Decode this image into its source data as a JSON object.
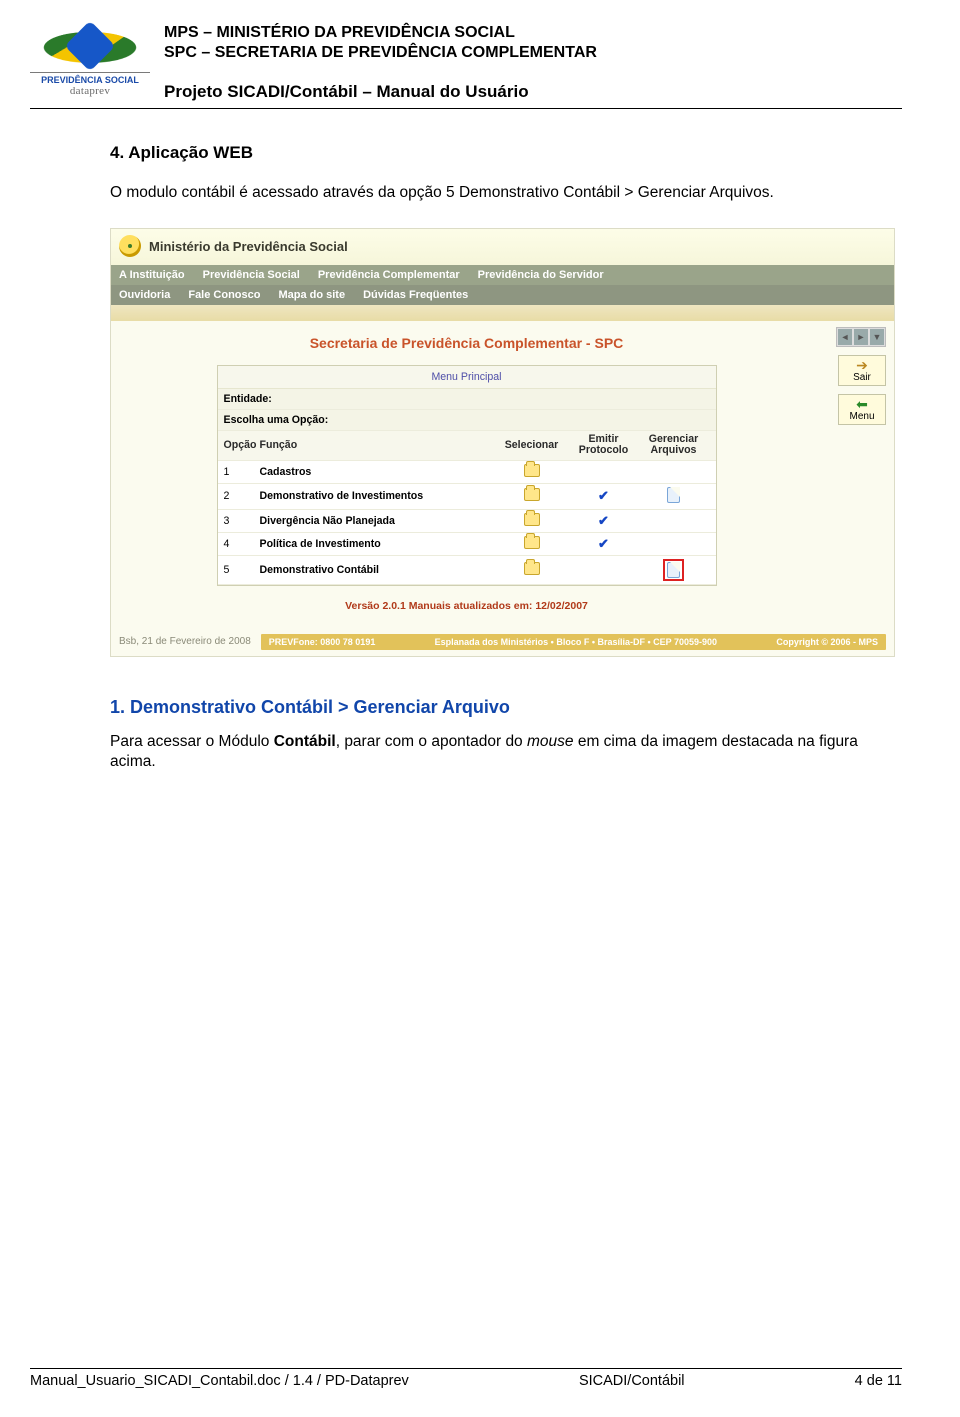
{
  "header": {
    "line1": "MPS – MINISTÉRIO DA PREVIDÊNCIA SOCIAL",
    "line2": "SPC – SECRETARIA DE PREVIDÊNCIA COMPLEMENTAR",
    "project": "Projeto SICADI/Contábil – Manual do Usuário",
    "logo_caption": "PREVIDÊNCIA SOCIAL",
    "logo_sub": "dataprev"
  },
  "section4": {
    "title": "4.  Aplicação WEB",
    "intro": "O modulo contábil é acessado através da opção 5 Demonstrativo Contábil > Gerenciar Arquivos."
  },
  "screenshot": {
    "top_title": "Ministério da Previdência Social",
    "nav1": [
      "A Instituição",
      "Previdência Social",
      "Previdência Complementar",
      "Previdência do Servidor"
    ],
    "nav2": [
      "Ouvidoria",
      "Fale Conosco",
      "Mapa do site",
      "Dúvidas Freqüentes"
    ],
    "sair_label": "Sair",
    "menu_label": "Menu",
    "spc_title": "Secretaria de Previdência Complementar - SPC",
    "menu_principal": "Menu Principal",
    "entidade_label": "Entidade:",
    "escolha_label": "Escolha uma Opção:",
    "columns": {
      "opcao": "Opção",
      "funcao": "Função",
      "selecionar": "Selecionar",
      "emitir": "Emitir Protocolo",
      "gerenciar": "Gerenciar Arquivos"
    },
    "rows": [
      {
        "n": "1",
        "funcao": "Cadastros",
        "sel": true,
        "emit": false,
        "ger": false
      },
      {
        "n": "2",
        "funcao": "Demonstrativo de Investimentos",
        "sel": true,
        "emit": true,
        "ger": true
      },
      {
        "n": "3",
        "funcao": "Divergência Não Planejada",
        "sel": true,
        "emit": true,
        "ger": false
      },
      {
        "n": "4",
        "funcao": "Política de Investimento",
        "sel": true,
        "emit": true,
        "ger": false
      },
      {
        "n": "5",
        "funcao": "Demonstrativo Contábil",
        "sel": true,
        "emit": false,
        "ger": true,
        "highlight": true
      }
    ],
    "version": "Versão 2.0.1 Manuais atualizados em: 12/02/2007",
    "footer_date": "Bsb, 21 de Fevereiro de 2008",
    "footer_bar": {
      "left": "PREVFone: 0800 78 0191",
      "mid": "Esplanada dos Ministérios • Bloco F • Brasília-DF • CEP 70059-900",
      "right": "Copyright © 2006 - MPS"
    }
  },
  "section1": {
    "title": "1.  Demonstrativo Contábil > Gerenciar Arquivo",
    "para_prefix": "Para acessar o Módulo ",
    "bold": "Contábil",
    "mid": ", parar com o apontador do ",
    "italic": "mouse",
    "suffix": " em cima da imagem destacada na figura acima."
  },
  "footer": {
    "left": "Manual_Usuario_SICADI_Contabil.doc / 1.4 /  PD-Dataprev",
    "center": "SICADI/Contábil",
    "right": "4 de 11"
  }
}
